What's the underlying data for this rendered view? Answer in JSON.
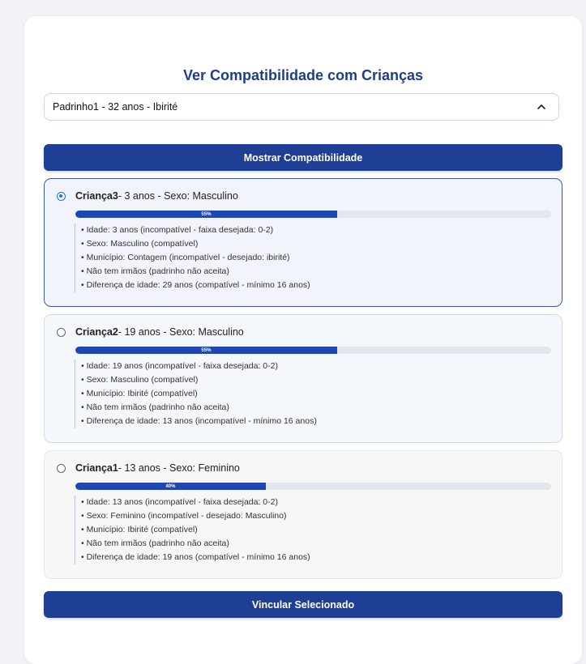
{
  "title": "Ver Compatibilidade com Crianças",
  "select": {
    "value": "Padrinho1 - 32 anos - Ibirité",
    "icon": "chevron-up-icon"
  },
  "show_button": "Mostrar Compatibilidade",
  "link_button": "Vincular Selecionado",
  "accent_color": "#1f3f95",
  "items": [
    {
      "name": "Criança3",
      "info": " - 3 anos - Sexo: Masculino",
      "selected": true,
      "percent": 55,
      "percent_label": "55%",
      "details": [
        "• Idade: 3 anos (incompatível - faixa desejada: 0-2)",
        "• Sexo: Masculino (compatível)",
        "• Município: Contagem (incompatível - desejado: ibirité)",
        "• Não tem irmãos (padrinho não aceita)",
        "• Diferença de idade: 29 anos (compatível - mínimo 16 anos)"
      ]
    },
    {
      "name": "Criança2",
      "info": " - 19 anos - Sexo: Masculino",
      "selected": false,
      "percent": 55,
      "percent_label": "55%",
      "details": [
        "• Idade: 19 anos (incompatível - faixa desejada: 0-2)",
        "• Sexo: Masculino (compatível)",
        "• Município: Ibirité (compatível)",
        "• Não tem irmãos (padrinho não aceita)",
        "• Diferença de idade: 13 anos (incompatível - mínimo 16 anos)"
      ]
    },
    {
      "name": "Criança1",
      "info": " - 13 anos - Sexo: Feminino",
      "selected": false,
      "percent": 40,
      "percent_label": "40%",
      "details": [
        "• Idade: 13 anos (incompatível - faixa desejada: 0-2)",
        "• Sexo: Feminino (incompatível - desejado: Masculino)",
        "• Município: Ibirité (compatível)",
        "• Não tem irmãos (padrinho não aceita)",
        "• Diferença de idade: 19 anos (compatível - mínimo 16 anos)"
      ]
    }
  ]
}
